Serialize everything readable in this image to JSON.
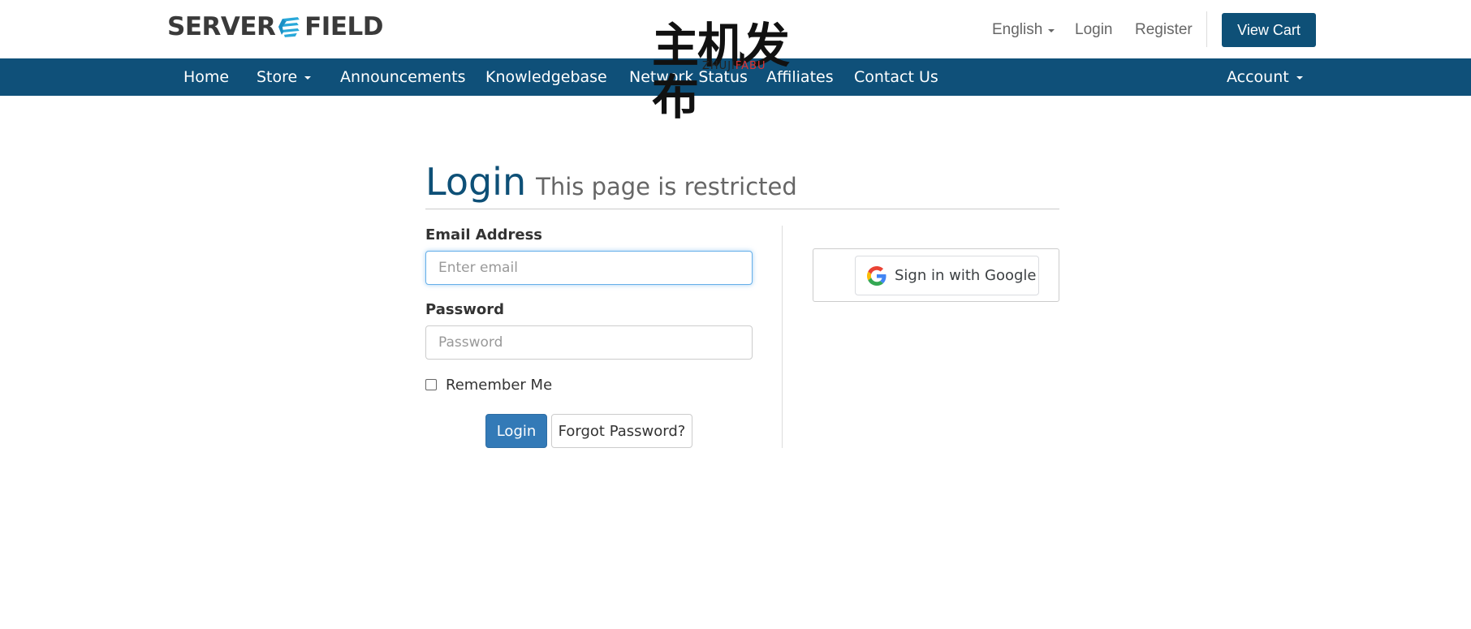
{
  "brand": {
    "logo_left": "SERVER",
    "logo_right": "FIELD",
    "accent": "#0f5079",
    "logo_cyan": "#29a8d9"
  },
  "watermark": {
    "cn": "主机发布",
    "en_dark": "ZHUJI",
    "en_red": "FABU"
  },
  "topnav": {
    "language": "English",
    "login": "Login",
    "register": "Register",
    "view_cart": "View Cart"
  },
  "mainnav": {
    "items": [
      {
        "label": "Home"
      },
      {
        "label": "Store"
      },
      {
        "label": "Announcements"
      },
      {
        "label": "Knowledgebase"
      },
      {
        "label": "Network Status"
      },
      {
        "label": "Affiliates"
      },
      {
        "label": "Contact Us"
      }
    ],
    "account": "Account"
  },
  "page": {
    "title": "Login",
    "subtitle": "This page is restricted"
  },
  "form": {
    "email_label": "Email Address",
    "email_placeholder": "Enter email",
    "password_label": "Password",
    "password_placeholder": "Password",
    "remember_label": "Remember Me",
    "login_button": "Login",
    "forgot_button": "Forgot Password?"
  },
  "social": {
    "google_label": "Sign in with Google"
  },
  "icons": [
    "caret-down-icon",
    "google-icon",
    "logo-mark-icon"
  ]
}
